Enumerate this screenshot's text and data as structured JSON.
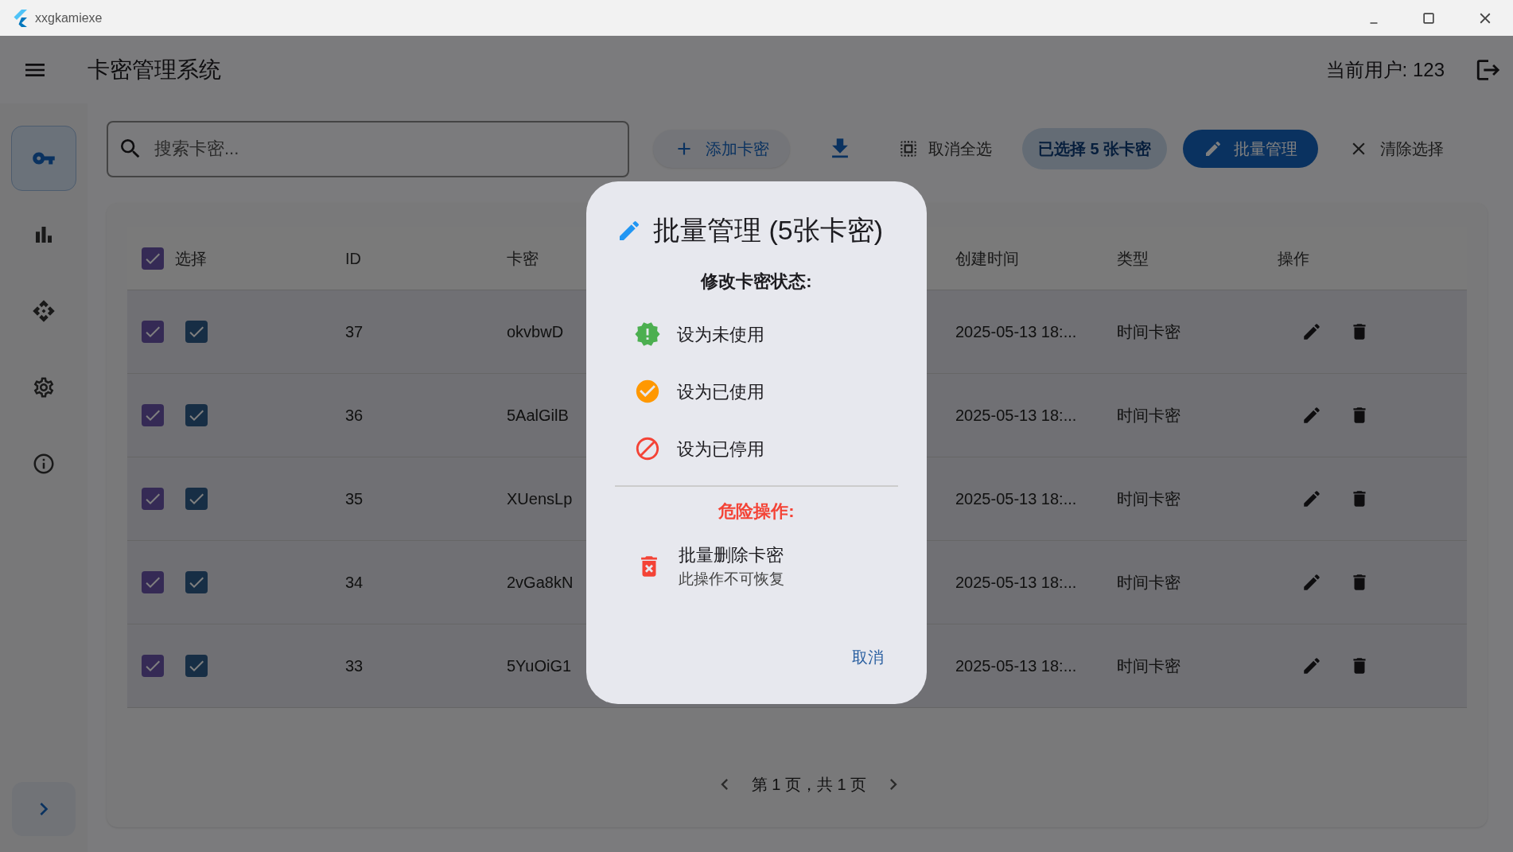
{
  "window": {
    "title": "xxgkamiexe"
  },
  "app_bar": {
    "title": "卡密管理系统",
    "current_user": "当前用户: 123"
  },
  "sidebar": {
    "items": [
      {
        "selected": true
      },
      {
        "selected": false
      },
      {
        "selected": false
      },
      {
        "selected": false
      },
      {
        "selected": false
      }
    ]
  },
  "toolbar": {
    "search": {
      "placeholder": "搜索卡密..."
    },
    "add_button": "添加卡密",
    "deselect_all": "取消全选",
    "selection_count": "已选择 5 张卡密",
    "batch_button": "批量管理",
    "clear_selection": "清除选择"
  },
  "table": {
    "select_all": true,
    "columns": [
      "选择",
      "ID",
      "卡密",
      "创建时间",
      "类型",
      "操作"
    ],
    "rows": [
      {
        "selected": true,
        "checked": true,
        "id": "37",
        "key": "okvbwD",
        "created": "2025-05-13 18:...",
        "type": "时间卡密"
      },
      {
        "selected": true,
        "checked": true,
        "id": "36",
        "key": "5AalGilB",
        "created": "2025-05-13 18:...",
        "type": "时间卡密"
      },
      {
        "selected": true,
        "checked": true,
        "id": "35",
        "key": "XUensLp",
        "created": "2025-05-13 18:...",
        "type": "时间卡密"
      },
      {
        "selected": true,
        "checked": true,
        "id": "34",
        "key": "2vGa8kN",
        "created": "2025-05-13 18:...",
        "type": "时间卡密"
      },
      {
        "selected": true,
        "checked": true,
        "id": "33",
        "key": "5YuOiG1",
        "created": "2025-05-13 18:...",
        "type": "时间卡密"
      }
    ]
  },
  "pagination": {
    "label": "第 1 页，共 1 页"
  },
  "dialog": {
    "title": "批量管理 (5张卡密)",
    "status_heading": "修改卡密状态:",
    "status_options": [
      "设为未使用",
      "设为已使用",
      "设为已停用"
    ],
    "danger_heading": "危险操作:",
    "danger_action": {
      "title": "批量删除卡密",
      "subtitle": "此操作不可恢复"
    },
    "cancel": "取消"
  }
}
